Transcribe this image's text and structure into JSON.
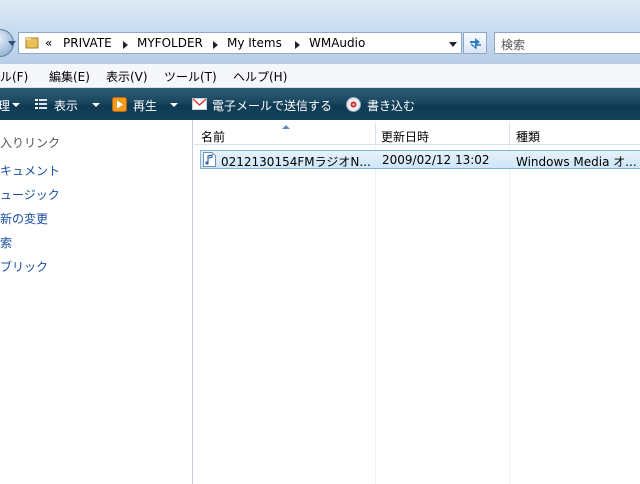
{
  "address_bar": {
    "overflow": "«",
    "crumbs": [
      "PRIVATE",
      "MYFOLDER",
      "My Items",
      "WMAudio"
    ]
  },
  "search": {
    "placeholder": "検索"
  },
  "menu": {
    "file": "ル(F)",
    "edit": "編集(E)",
    "view": "表示(V)",
    "tools": "ツール(T)",
    "help": "ヘルプ(H)"
  },
  "command_bar": {
    "organize": "理",
    "views": "表示",
    "play": "再生",
    "email": "電子メールで送信する",
    "burn": "書き込む"
  },
  "nav_pane": {
    "favorites_header": "入りリンク",
    "links": [
      "キュメント",
      "ュージック",
      "新の変更",
      "索",
      "ブリック"
    ]
  },
  "file_list": {
    "columns": {
      "name": "名前",
      "modified": "更新日時",
      "type": "種類"
    },
    "rows": [
      {
        "name": "0212130154FMラジオN...",
        "modified": "2009/02/12 13:02",
        "type": "Windows Media オ..."
      }
    ]
  },
  "icons": {
    "folder": "folder-icon",
    "refresh": "refresh-icon",
    "views": "views-icon",
    "play": "play-icon",
    "email": "email-icon",
    "burn": "burn-icon",
    "audio_file": "audio-file-icon"
  },
  "colors": {
    "command_bar": "#1d4a63",
    "link": "#1a4fa0",
    "selection": "#cde6f7"
  }
}
